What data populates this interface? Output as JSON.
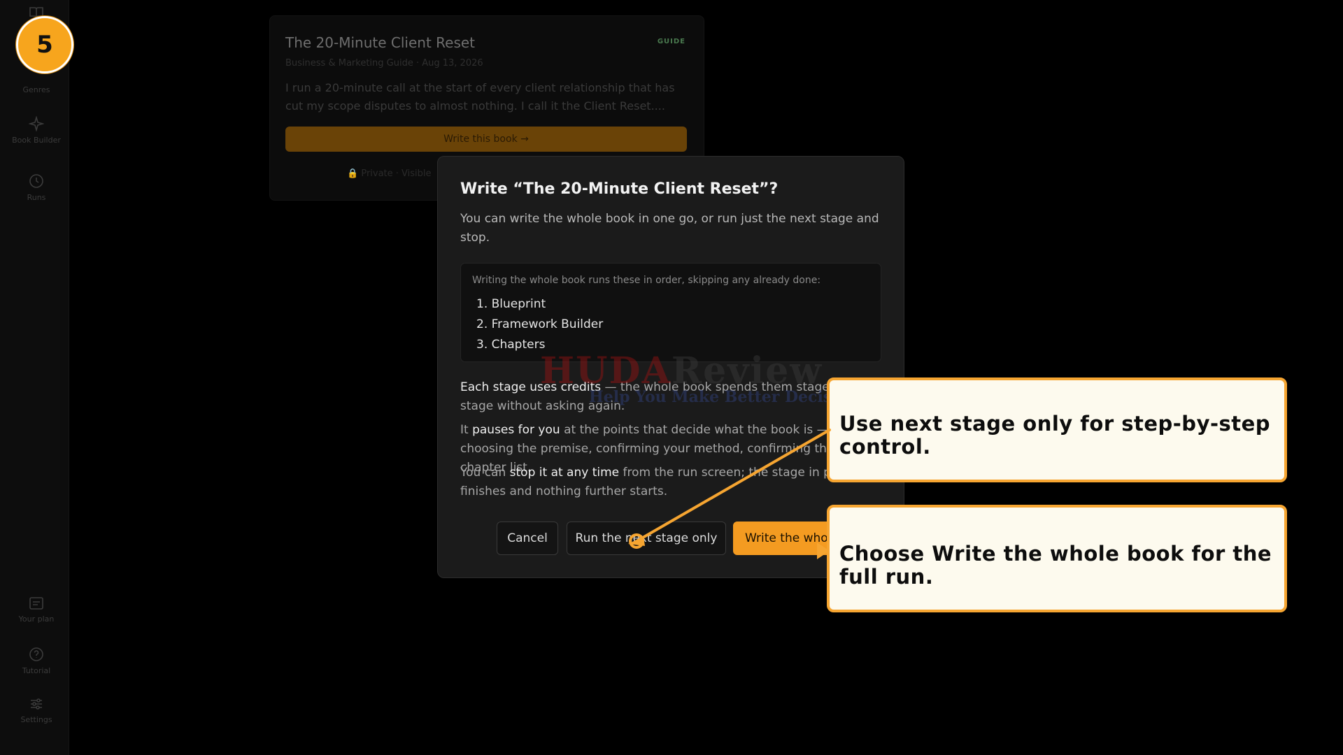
{
  "step": {
    "number": "5"
  },
  "sidebar": {
    "items": [
      {
        "label": "Genres",
        "icon": "book-icon"
      },
      {
        "label": "Book Builder",
        "icon": "sparkle-icon"
      },
      {
        "label": "Runs",
        "icon": "clock-icon"
      },
      {
        "label": "Your plan",
        "icon": "card-icon"
      },
      {
        "label": "Tutorial",
        "icon": "help-icon"
      },
      {
        "label": "Settings",
        "icon": "sliders-icon"
      }
    ]
  },
  "background_card": {
    "title": "The 20-Minute Client Reset",
    "badge": "GUIDE",
    "meta": "Business & Marketing Guide · Aug 13, 2026",
    "description": "I run a 20-minute call at the start of every client relationship that has cut my scope disputes to almost nothing. I call it the Client Reset....",
    "write_button": "Write this book →",
    "note": "Private · Visible"
  },
  "modal": {
    "title": "Write “The 20-Minute Client Reset”?",
    "subtitle": "You can write the whole book in one go, or run just the next stage and stop.",
    "steps_intro": "Writing the whole book runs these in order, skipping any already done:",
    "steps": [
      "1. Blueprint",
      "2. Framework Builder",
      "3. Chapters"
    ],
    "para1_bold": "Each stage uses credits",
    "para1_rest": " — the whole book spends them stage after stage without asking again.",
    "para2_pre": "It ",
    "para2_bold": "pauses for you",
    "para2_rest": " at the points that decide what the book is — choosing the premise, confirming your method, confirming the chapter list.",
    "para3_pre": "You can ",
    "para3_bold": "stop it at any time",
    "para3_rest": " from the run screen; the stage in progress finishes and nothing further starts.",
    "cancel_label": "Cancel",
    "next_stage_label": "Run the next stage only",
    "whole_book_label": "Write the whole book"
  },
  "watermark": {
    "brand_red": "HUDA",
    "brand_dark": "Review",
    "tagline": "Help You Make Better Decisions"
  },
  "callouts": {
    "first": "Use next stage only for step-by-step control.",
    "second": "Choose Write the whole book for the full run."
  },
  "colors": {
    "accent": "#f49b21",
    "callout_border": "#f6a531",
    "callout_bg": "#fdfaee"
  }
}
